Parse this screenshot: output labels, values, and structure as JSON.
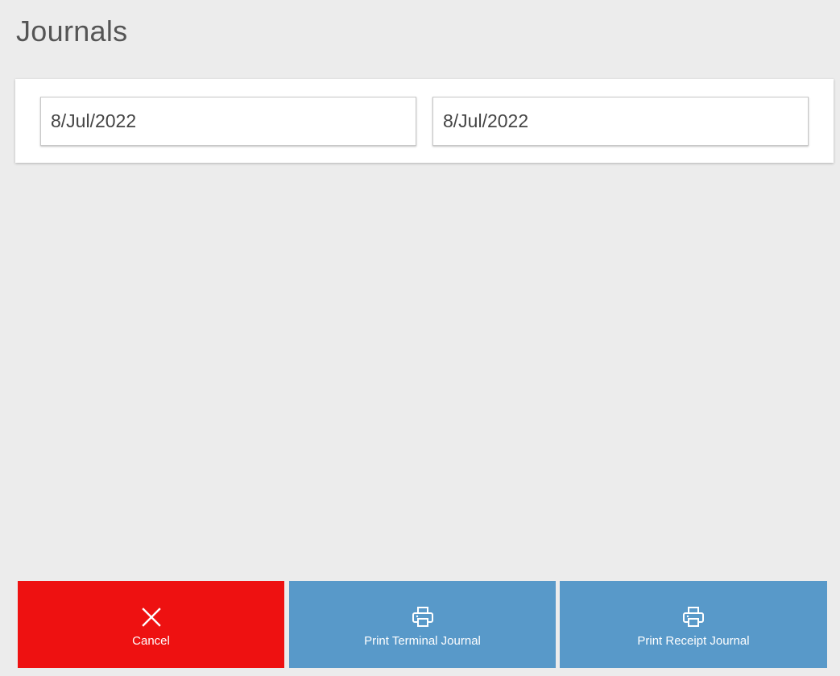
{
  "header": {
    "title": "Journals"
  },
  "date_range": {
    "from_value": "8/Jul/2022",
    "to_value": "8/Jul/2022"
  },
  "actions": {
    "cancel": {
      "label": "Cancel",
      "icon": "close-icon",
      "color": "#ee1111"
    },
    "print_terminal": {
      "label": "Print Terminal Journal",
      "icon": "printer-icon",
      "color": "#5899c9"
    },
    "print_receipt": {
      "label": "Print Receipt Journal",
      "icon": "printer-icon",
      "color": "#5899c9"
    }
  }
}
